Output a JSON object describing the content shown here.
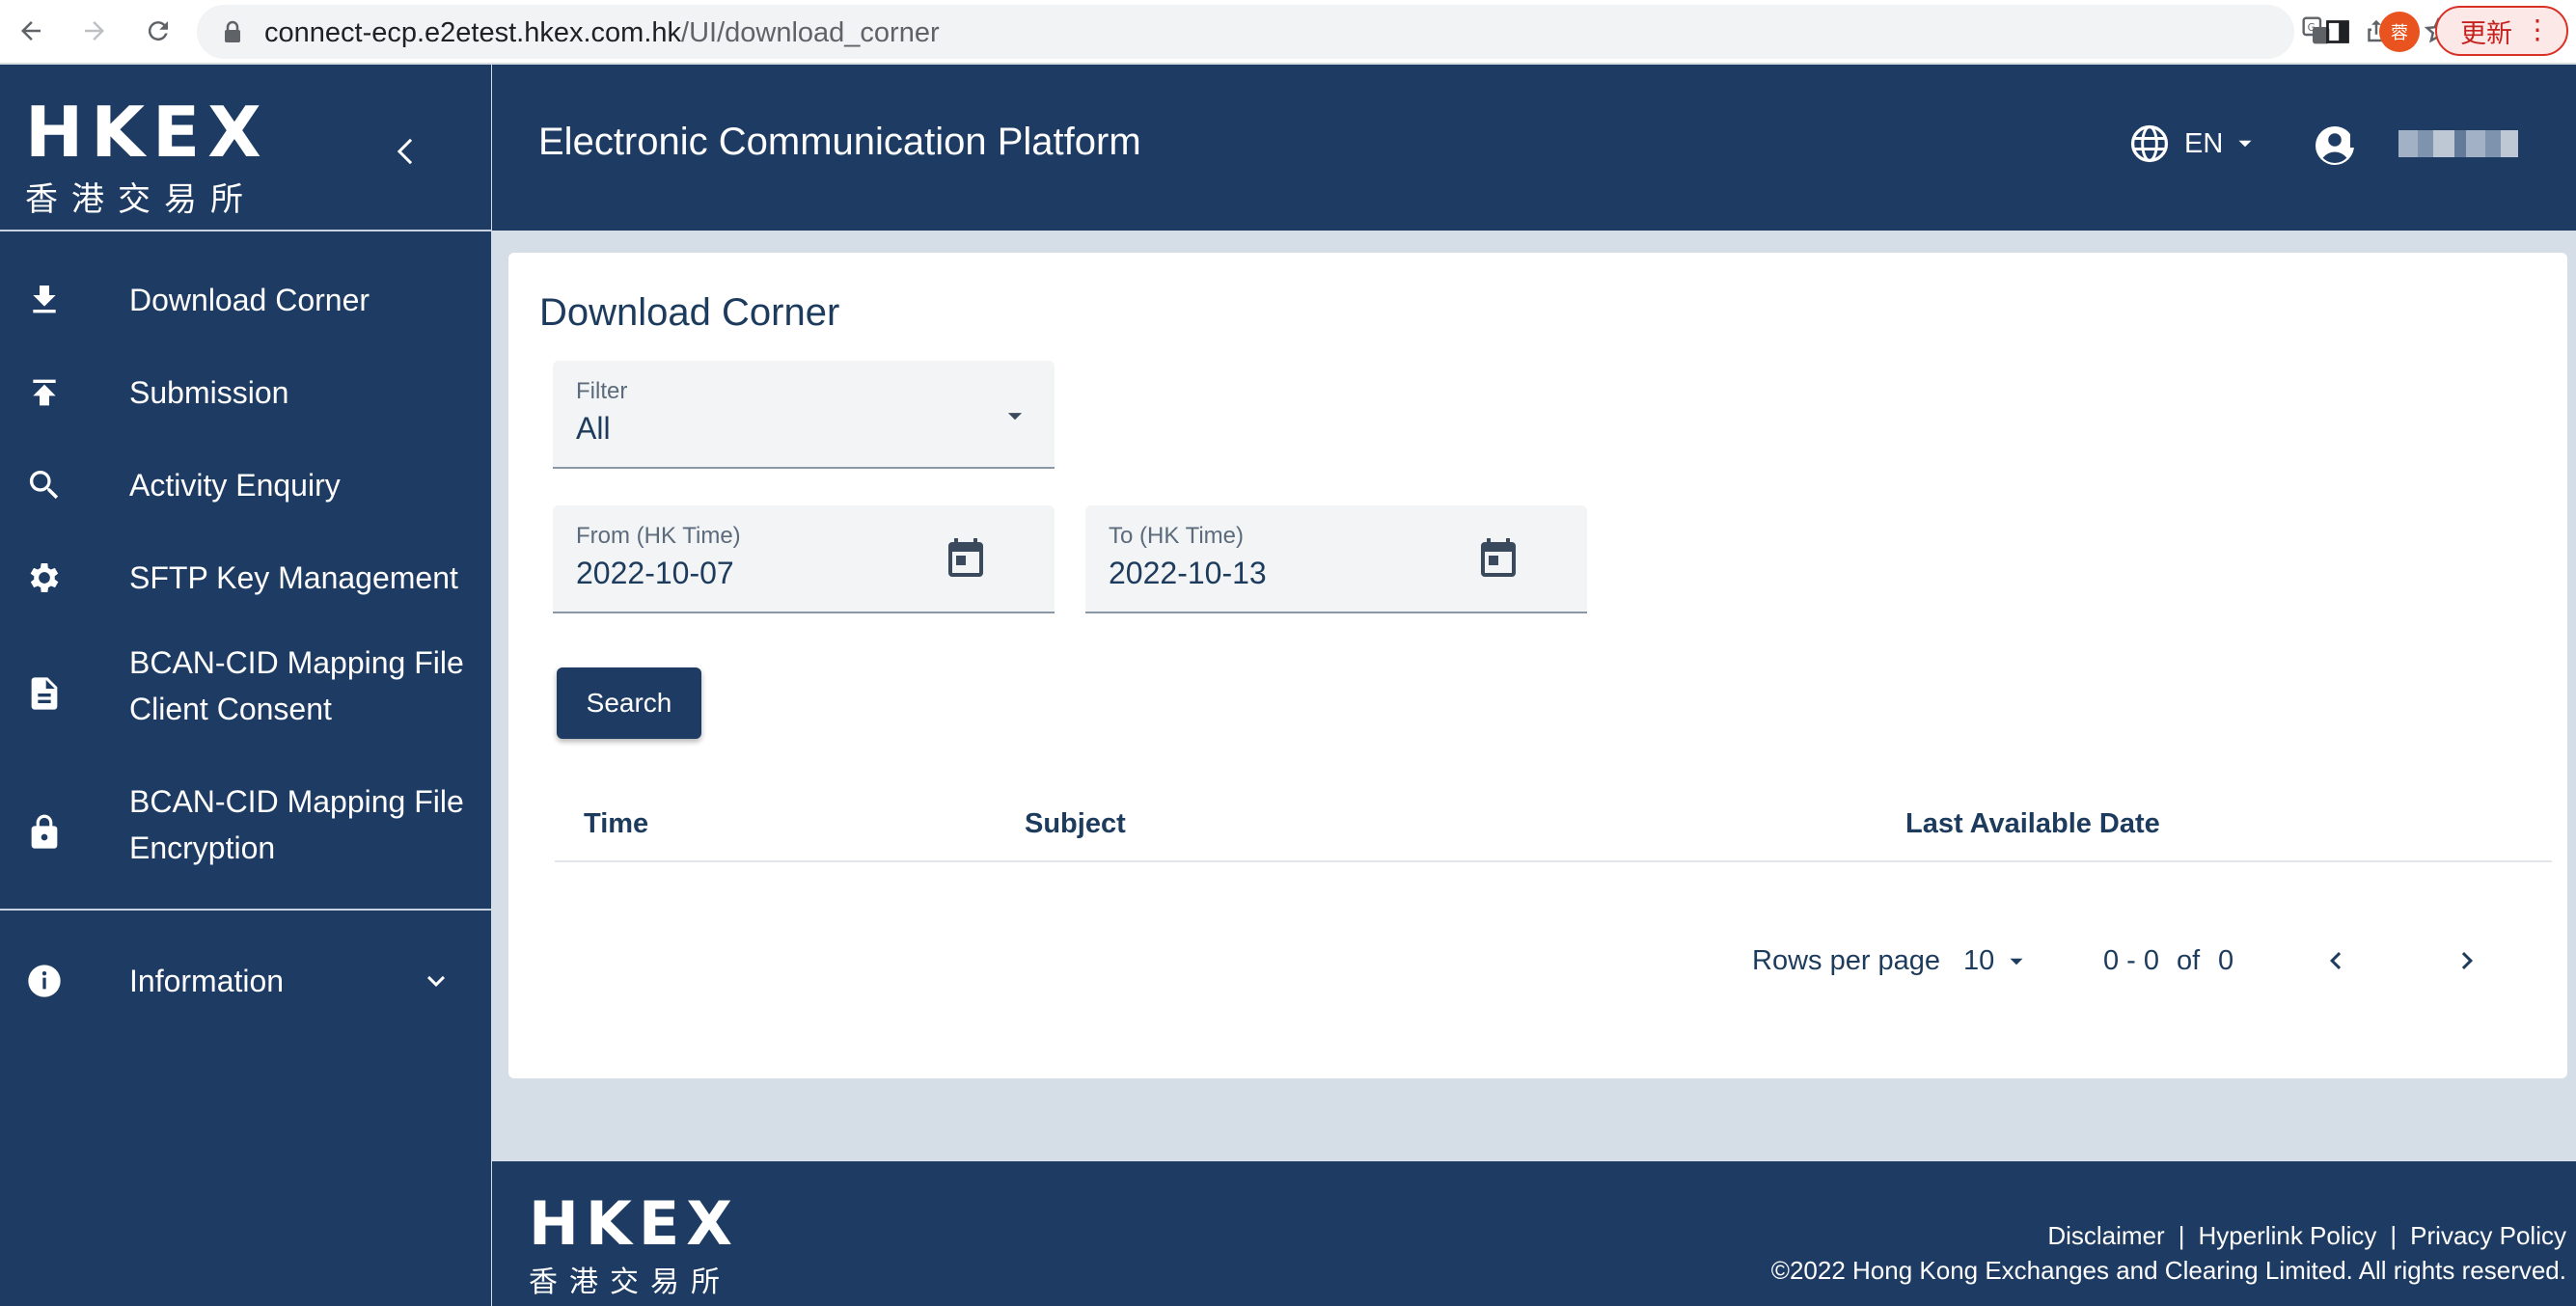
{
  "browser": {
    "url_host": "connect-ecp.e2etest.hkex.com.hk",
    "url_path": "/UI/download_corner",
    "profile_initial": "蓉",
    "update_label": "更新"
  },
  "sidebar": {
    "logo_latin": "HKEX",
    "logo_cjk": "香港交易所",
    "items": [
      {
        "label_lines": [
          "Download Corner"
        ],
        "icon": "download-icon"
      },
      {
        "label_lines": [
          "Submission"
        ],
        "icon": "upload-icon"
      },
      {
        "label_lines": [
          "Activity Enquiry"
        ],
        "icon": "search-icon"
      },
      {
        "label_lines": [
          "SFTP Key Management"
        ],
        "icon": "gear-icon"
      },
      {
        "label_lines": [
          "BCAN-CID Mapping File",
          "Client Consent"
        ],
        "icon": "document-icon"
      },
      {
        "label_lines": [
          "BCAN-CID Mapping File",
          "Encryption"
        ],
        "icon": "lock-icon"
      }
    ],
    "information": {
      "label": "Information",
      "icon": "info-icon"
    }
  },
  "header": {
    "title": "Electronic Communication Platform",
    "language": "EN"
  },
  "main": {
    "title": "Download Corner",
    "filter": {
      "label": "Filter",
      "value": "All"
    },
    "from": {
      "label": "From (HK Time)",
      "value": "2022-10-07"
    },
    "to": {
      "label": "To (HK Time)",
      "value": "2022-10-13"
    },
    "search_label": "Search",
    "table": {
      "columns": [
        "Time",
        "Subject",
        "Last Available Date"
      ],
      "rows": []
    },
    "pagination": {
      "rows_per_page_label": "Rows per page",
      "rows_per_page": "10",
      "range": "0 - 0",
      "of_label": "of",
      "total": "0"
    }
  },
  "footer": {
    "logo_latin": "HKEX",
    "logo_cjk": "香港交易所",
    "links": [
      "Disclaimer",
      "Hyperlink Policy",
      "Privacy Policy"
    ],
    "separator": "|",
    "copyright": "©2022 Hong Kong Exchanges and Clearing Limited. All rights reserved."
  },
  "colors": {
    "primary": "#1e3c63",
    "background": "#d5dde6",
    "card": "#ffffff"
  }
}
